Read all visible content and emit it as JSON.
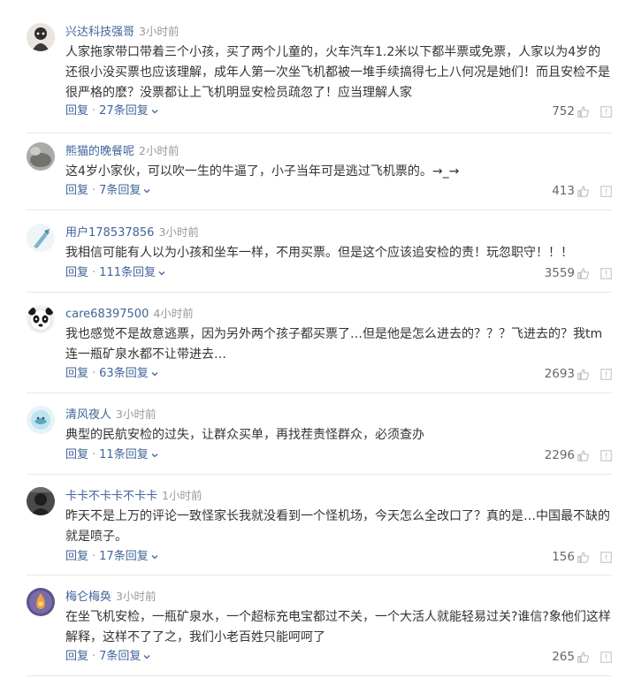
{
  "comments": [
    {
      "username": "兴达科技强哥",
      "time": "3小时前",
      "text": "人家拖家带口带着三个小孩，买了两个儿童的，火车汽车1.2米以下都半票或免票，人家以为4岁的还很小没买票也应该理解，成年人第一次坐飞机都被一堆手续搞得七上八何况是她们！而且安检不是很严格的麽？没票都让上飞机明显安检员疏忽了！应当理解人家",
      "reply": "回复",
      "replies": "27条回复",
      "likes": "752",
      "avatar_color": "#3a3a3a"
    },
    {
      "username": "熊猫的晚餐呢",
      "time": "2小时前",
      "text": "这4岁小家伙，可以吹一生的牛逼了，小子当年可是逃过飞机票的。→_→",
      "reply": "回复",
      "replies": "7条回复",
      "likes": "413",
      "avatar_color": "#8a8a86"
    },
    {
      "username": "用户178537856",
      "time": "3小时前",
      "text": "我相信可能有人以为小孩和坐车一样，不用买票。但是这个应该追安检的责！玩忽职守！！！",
      "reply": "回复",
      "replies": "111条回复",
      "likes": "3559",
      "avatar_color": "#cfe3ea"
    },
    {
      "username": "care68397500",
      "time": "4小时前",
      "text": "我也感觉不是故意逃票，因为另外两个孩子都买票了…但是他是怎么进去的？？？飞进去的？我tm连一瓶矿泉水都不让带进去…",
      "reply": "回复",
      "replies": "63条回复",
      "likes": "2693",
      "avatar_color": "#e8e8e8"
    },
    {
      "username": "清风夜人",
      "time": "3小时前",
      "text": "典型的民航安检的过失，让群众买单，再找茬责怪群众，必须查办",
      "reply": "回复",
      "replies": "11条回复",
      "likes": "2296",
      "avatar_color": "#d6edf5"
    },
    {
      "username": "卡卡不卡卡不卡卡",
      "time": "1小时前",
      "text": "昨天不是上万的评论一致怪家长我就没看到一个怪机场，今天怎么全改口了？真的是…中国最不缺的就是喷子。",
      "reply": "回复",
      "replies": "17条回复",
      "likes": "156",
      "avatar_color": "#2e2e2e"
    },
    {
      "username": "梅仑梅奂",
      "time": "3小时前",
      "text": "在坐飞机安检，一瓶矿泉水，一个超标充电宝都过不关，一个大活人就能轻易过关?谁信?象他们这样解释，这样不了了之，我们小老百姓只能呵呵了",
      "reply": "回复",
      "replies": "7条回复",
      "likes": "265",
      "avatar_color": "#6a5b8e"
    }
  ]
}
